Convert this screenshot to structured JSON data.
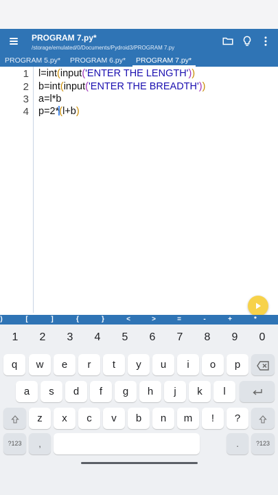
{
  "header": {
    "title": "PROGRAM 7.py*",
    "path": "/storage/emulated/0/Documents/Pydroid3/PROGRAM 7.py",
    "menu_icon": "menu-icon",
    "folder_icon": "folder-icon",
    "tip_icon": "lightbulb-icon",
    "more_icon": "more-vert-icon"
  },
  "tabs": [
    {
      "label": "PROGRAM 5.py*"
    },
    {
      "label": "PROGRAM 6.py*"
    },
    {
      "label": "PROGRAM 7.py*"
    }
  ],
  "editor": {
    "lines": [
      {
        "num": "1",
        "pre": "l=int",
        "p1o": "(",
        "fn": "input",
        "p2o": "(",
        "str": "'ENTER THE LENGTH'",
        "p2c": ")",
        "p1c": ")"
      },
      {
        "num": "2",
        "pre": "b=int",
        "p1o": "(",
        "fn": "input",
        "p2o": "(",
        "str": "'ENTER THE BREADTH'",
        "p2c": ")",
        "p1c": ")"
      },
      {
        "num": "3",
        "text": "a=l*b"
      },
      {
        "num": "4",
        "pre": "p=2*",
        "p1o": "(",
        "mid": "l+b",
        "p1c": ")"
      }
    ]
  },
  "run_button": {
    "icon": "play-icon",
    "color": "#f7d24a"
  },
  "symbols": [
    ")",
    "[",
    "]",
    "{",
    "}",
    "<",
    ">",
    "=",
    "-",
    "+",
    "*"
  ],
  "keyboard": {
    "numbers": [
      "1",
      "2",
      "3",
      "4",
      "5",
      "6",
      "7",
      "8",
      "9",
      "0"
    ],
    "row1": [
      "q",
      "w",
      "e",
      "r",
      "t",
      "y",
      "u",
      "i",
      "o",
      "p"
    ],
    "row2": [
      "a",
      "s",
      "d",
      "f",
      "g",
      "h",
      "j",
      "k",
      "l"
    ],
    "row3": [
      "z",
      "x",
      "c",
      "v",
      "b",
      "n",
      "m",
      "!",
      "?"
    ],
    "sym_key": "?123",
    "comma": ",",
    "period": "."
  },
  "colors": {
    "accent": "#2f74b5",
    "string": "#1a0fb0",
    "paren_outer": "#c88a00",
    "paren_inner": "#9a2cb8"
  }
}
